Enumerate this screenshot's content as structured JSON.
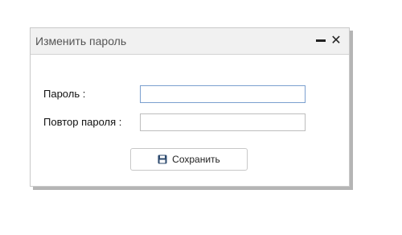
{
  "dialog": {
    "title": "Изменить пароль",
    "minimize_icon": "minus-icon",
    "close_icon": "close-icon",
    "close_glyph": "✕"
  },
  "form": {
    "password_label": "Пароль :",
    "password_value": "",
    "repeat_label": "Повтор пароля :",
    "repeat_value": ""
  },
  "actions": {
    "save_label": "Сохранить",
    "save_icon": "floppy-disk-icon"
  },
  "colors": {
    "titlebar_bg": "#f1f1f1",
    "focus_border": "#7ba0cf",
    "save_icon": "#2c4a6e"
  }
}
